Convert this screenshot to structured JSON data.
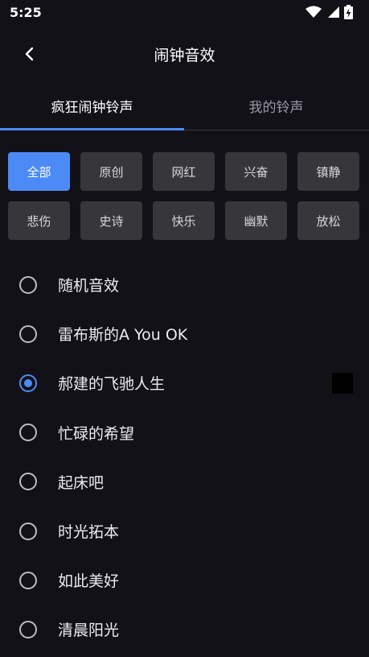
{
  "status_bar": {
    "time": "5:25",
    "icons": [
      "wifi-icon",
      "signal-icon",
      "battery-charging-icon"
    ]
  },
  "header": {
    "back_icon": "chevron-left-icon",
    "title": "闹钟音效"
  },
  "tabs": [
    {
      "label": "疯狂闹钟铃声",
      "active": true
    },
    {
      "label": "我的铃声",
      "active": false
    }
  ],
  "categories": [
    {
      "label": "全部",
      "active": true
    },
    {
      "label": "原创"
    },
    {
      "label": "网红"
    },
    {
      "label": "兴奋"
    },
    {
      "label": "镇静"
    },
    {
      "label": "悲伤"
    },
    {
      "label": "史诗"
    },
    {
      "label": "快乐"
    },
    {
      "label": "幽默"
    },
    {
      "label": "放松"
    }
  ],
  "sounds": [
    {
      "label": "随机音效",
      "selected": false
    },
    {
      "label": "雷布斯的A You OK",
      "selected": false
    },
    {
      "label": "郝建的飞驰人生",
      "selected": true
    },
    {
      "label": "忙碌的希望",
      "selected": false
    },
    {
      "label": "起床吧",
      "selected": false
    },
    {
      "label": "时光拓本",
      "selected": false
    },
    {
      "label": "如此美好",
      "selected": false
    },
    {
      "label": "清晨阳光",
      "selected": false
    }
  ],
  "colors": {
    "accent": "#4c8bf5",
    "background": "#131118",
    "chip": "#37363b"
  }
}
